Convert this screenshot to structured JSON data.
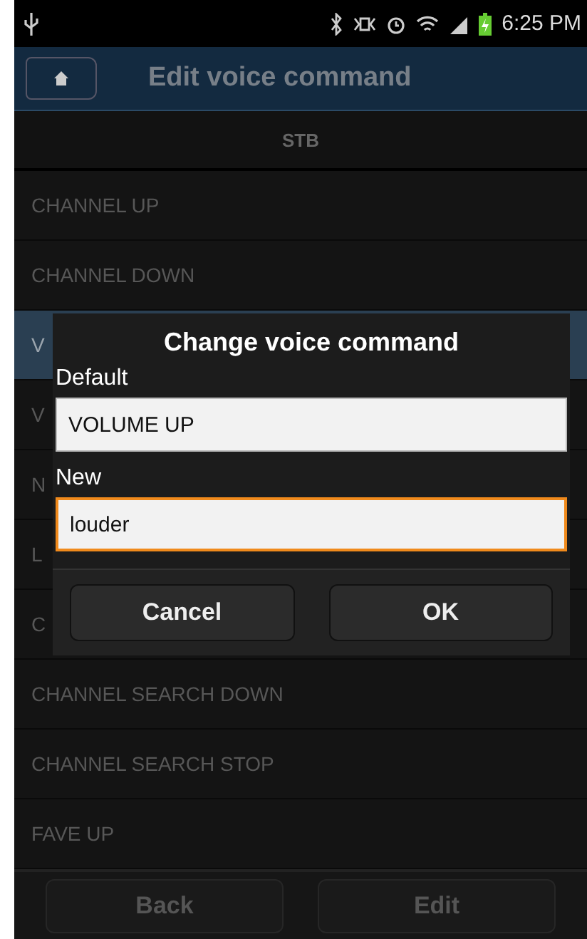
{
  "status_bar": {
    "time": "6:25 PM"
  },
  "title_bar": {
    "title": "Edit voice command"
  },
  "section": {
    "label": "STB"
  },
  "commands": [
    {
      "label": "CHANNEL UP",
      "selected": false
    },
    {
      "label": "CHANNEL DOWN",
      "selected": false
    },
    {
      "label": "V",
      "selected": true
    },
    {
      "label": "V",
      "selected": false
    },
    {
      "label": "N",
      "selected": false
    },
    {
      "label": "L",
      "selected": false
    },
    {
      "label": "C",
      "selected": false
    },
    {
      "label": "CHANNEL SEARCH DOWN",
      "selected": false
    },
    {
      "label": "CHANNEL SEARCH STOP",
      "selected": false
    },
    {
      "label": "FAVE UP",
      "selected": false
    }
  ],
  "dialog": {
    "title": "Change voice command",
    "default_label": "Default",
    "default_value": "VOLUME UP",
    "new_label": "New",
    "new_value": "louder",
    "buttons": [
      "Cancel",
      "OK"
    ]
  },
  "bottom_buttons": [
    "Back",
    "Edit"
  ]
}
